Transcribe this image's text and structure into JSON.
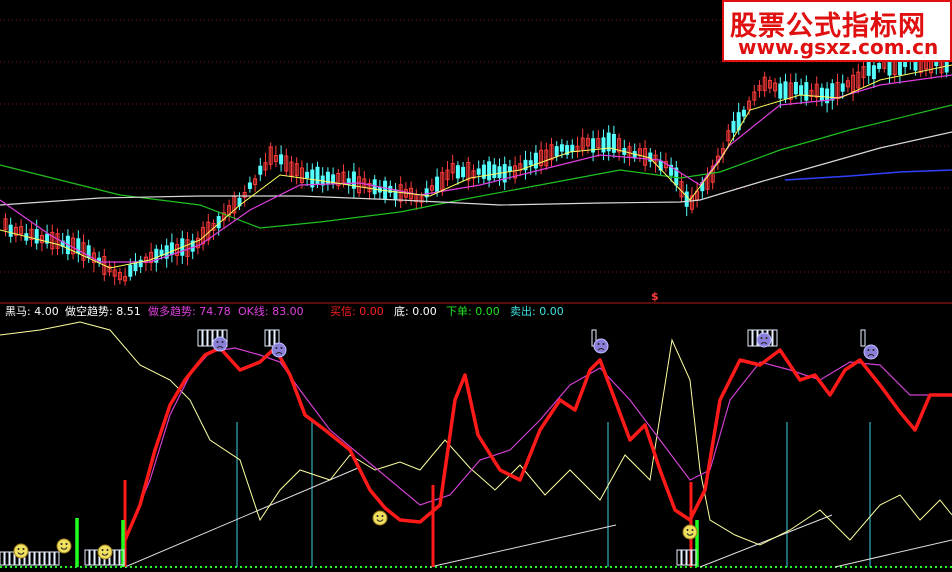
{
  "watermark": {
    "line1": "股票公式指标网",
    "line2": "www.gsxz.com.cn"
  },
  "marker": "$",
  "indicators": [
    {
      "label": "黑马",
      "value": "4.00",
      "color": "#ffffff"
    },
    {
      "label": "做空趋势",
      "value": "8.51",
      "color": "#ffffff"
    },
    {
      "label": "做多趋势",
      "value": "74.78",
      "color": "#e040e0"
    },
    {
      "label": "OK线",
      "value": "83.00",
      "color": "#e040e0"
    },
    {
      "label": "买信",
      "value": "0.00",
      "color": "#ff2020"
    },
    {
      "label": "底",
      "value": "0.00",
      "color": "#ffffff"
    },
    {
      "label": "下单",
      "value": "0.00",
      "color": "#20e020"
    },
    {
      "label": "卖出",
      "value": "0.00",
      "color": "#40e0e0"
    }
  ],
  "colors": {
    "up_candle": "#ff3b3b",
    "down_candle": "#54ffff",
    "ma_white": "#ffffff",
    "ma_yellow": "#ffff60",
    "ma_magenta": "#e040e0",
    "ma_green": "#20c020",
    "ma_blue": "#3040ff",
    "osc_red": "#ff1a1a",
    "osc_magenta": "#d040d0",
    "osc_yellow": "#ffffa0",
    "vline_cyan": "#40d0e0",
    "bar_green": "#20ff20"
  },
  "chart_data": {
    "type": "candlestick+oscillator",
    "indicator_readout": {
      "黑马": 4.0,
      "做空趋势": 8.51,
      "做多趋势": 74.78,
      "OK线": 83.0,
      "买信": 0.0,
      "底": 0.0,
      "下单": 0.0,
      "卖出": 0.0
    },
    "candles_count": 180
  }
}
